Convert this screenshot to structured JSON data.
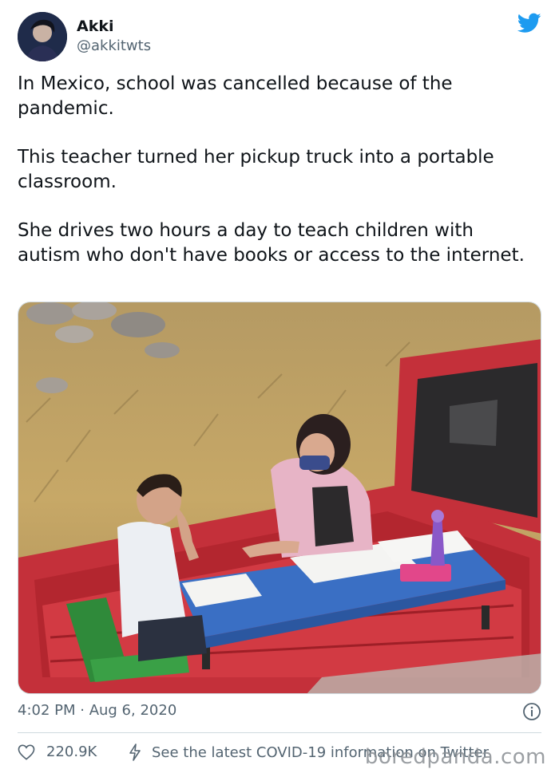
{
  "author": {
    "display_name": "Akki",
    "handle": "@akkitwts"
  },
  "tweet": {
    "paragraphs": [
      "In Mexico, school was cancelled because of the pandemic.",
      "This teacher turned her pickup truck into a portable classroom.",
      "She drives two hours a day to teach children with autism who don't have books or access to the internet."
    ],
    "timestamp": "4:02 PM · Aug 6, 2020"
  },
  "actions": {
    "like_count": "220.9K",
    "covid_link": "See the latest COVID-19 information on Twitter"
  },
  "watermark": "boredpanda.com",
  "icons": {
    "avatar": "avatar",
    "bird": "twitter-bird-icon",
    "info": "info-icon",
    "heart": "heart-icon",
    "lightning": "lightning-icon"
  },
  "colors": {
    "brand": "#1d9bf0",
    "text": "#0f1419",
    "secondary": "#536471",
    "divider": "#cfd9de"
  }
}
